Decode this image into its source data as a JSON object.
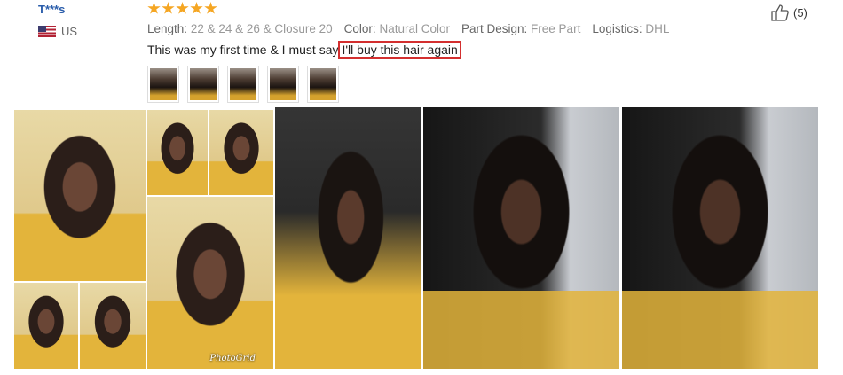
{
  "review": {
    "username": "T***s",
    "country": "US",
    "rating": 5,
    "specs": [
      {
        "key": "Length:",
        "value": "22 & 24 & 26 & Closure 20"
      },
      {
        "key": "Color:",
        "value": "Natural Color"
      },
      {
        "key": "Part Design:",
        "value": "Free Part"
      },
      {
        "key": "Logistics:",
        "value": "DHL"
      }
    ],
    "text_before": "This was my first time & I must say",
    "text_highlight": "I'll buy this hair again",
    "like_count": "(5)",
    "thumbnail_count": 5,
    "gallery_watermark": "PhotoGrid"
  },
  "colors": {
    "username": "#2a5dab",
    "star": "#f5a623",
    "highlight_border": "#d32f2f",
    "sweater_yellow": "#e3b43b"
  },
  "icons": {
    "flag": "us-flag-icon",
    "star": "star-icon",
    "like": "thumbs-up-icon"
  }
}
